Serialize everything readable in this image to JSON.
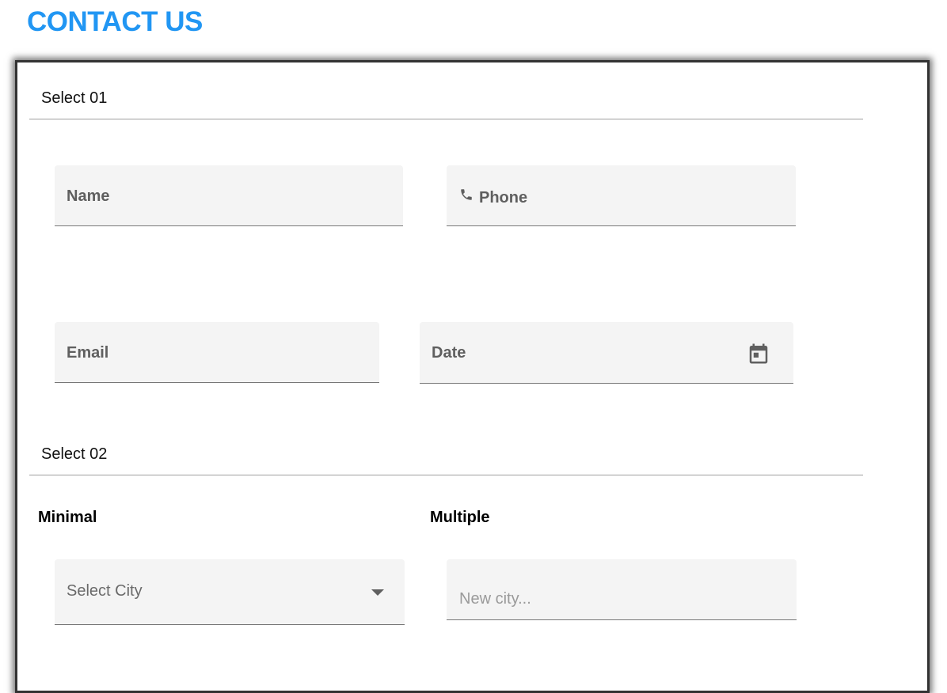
{
  "page": {
    "title": "CONTACT US",
    "title_color": "#2196f3"
  },
  "sections": {
    "select_01": "Select 01",
    "select_02": "Select 02"
  },
  "fields": {
    "name": {
      "label": "Name"
    },
    "phone": {
      "label": "Phone",
      "icon": "phone-icon"
    },
    "email": {
      "label": "Email"
    },
    "date": {
      "label": "Date",
      "icon": "calendar-icon"
    }
  },
  "select_group": {
    "minimal_label": "Minimal",
    "multiple_label": "Multiple",
    "city_select": {
      "value": "Select City",
      "icon": "dropdown-arrow-icon"
    },
    "city_input": {
      "placeholder": "New city..."
    }
  }
}
